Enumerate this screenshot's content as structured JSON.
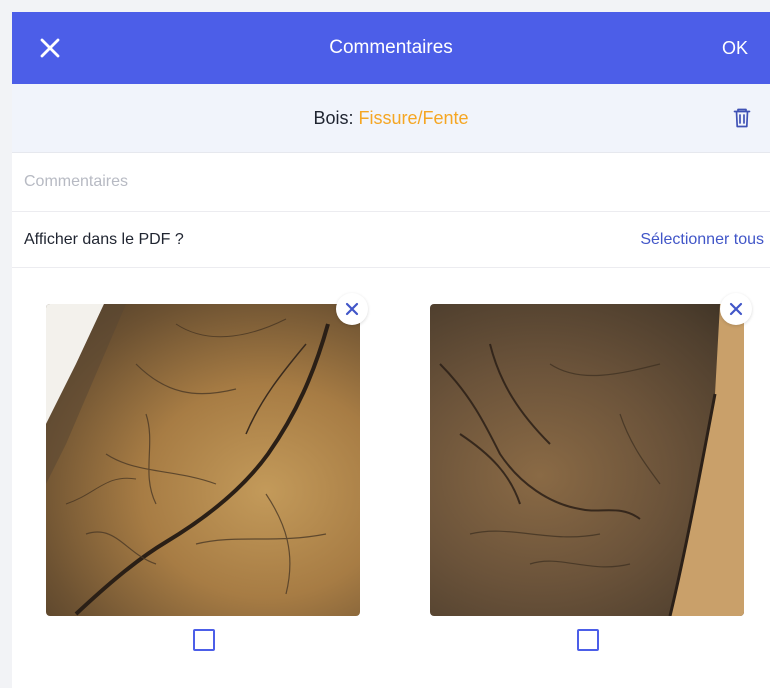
{
  "header": {
    "title": "Commentaires",
    "ok_label": "OK",
    "close_icon": "close-icon"
  },
  "category": {
    "label": "Bois:",
    "value": "Fissure/Fente",
    "value_color": "#f5a623",
    "delete_icon": "trash-icon"
  },
  "comment": {
    "placeholder": "Commentaires",
    "value": ""
  },
  "pdf": {
    "label": "Afficher dans le PDF ?",
    "select_all_label": "Sélectionner tous"
  },
  "photos": [
    {
      "remove_icon": "close-icon",
      "checked": false
    },
    {
      "remove_icon": "close-icon",
      "checked": false
    }
  ],
  "colors": {
    "accent": "#4c5ee8",
    "link": "#4156c8"
  }
}
